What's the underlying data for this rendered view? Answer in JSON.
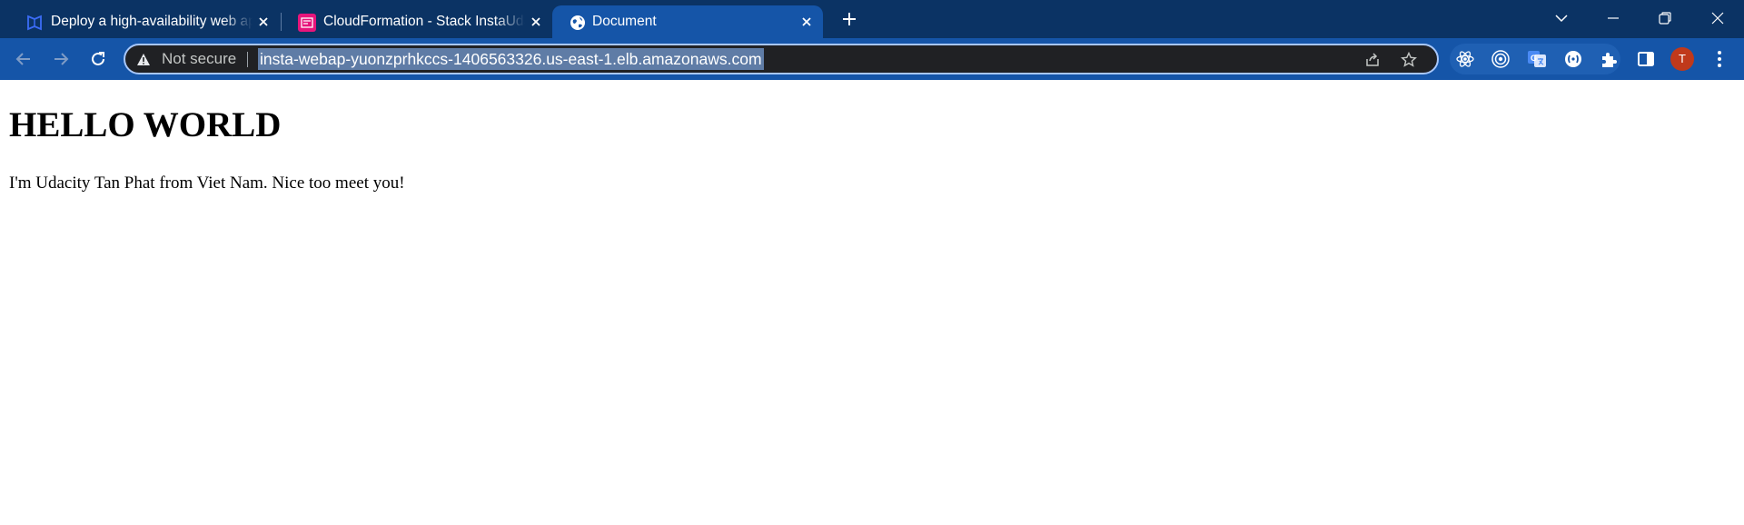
{
  "browser": {
    "tabs": [
      {
        "title": "Deploy a high-availability web ap",
        "favicon": "udacity-icon",
        "active": false
      },
      {
        "title": "CloudFormation - Stack InstaUda",
        "favicon": "cloudformation-icon",
        "active": false
      },
      {
        "title": "Document",
        "favicon": "globe-icon",
        "active": true
      }
    ],
    "new_tab_icon": "plus-icon",
    "window_controls": [
      "tab-search-icon",
      "minimize-icon",
      "restore-icon",
      "close-icon"
    ]
  },
  "toolbar": {
    "security_label": "Not secure",
    "url": "insta-webap-yuonzprhkccs-1406563326.us-east-1.elb.amazonaws.com",
    "extensions": [
      "react-devtools-icon",
      "radio-target-icon",
      "google-translate-icon",
      "extension-round-icon",
      "puzzle-icon",
      "side-panel-icon"
    ],
    "profile_initial": "T",
    "colors": {
      "tabstrip": "#0b3364",
      "toolbar": "#1555a8",
      "omnibox": "#202124",
      "avatar": "#c0391b"
    }
  },
  "page": {
    "heading": "HELLO WORLD",
    "paragraph": "I'm Udacity Tan Phat from Viet Nam. Nice too meet you!"
  }
}
